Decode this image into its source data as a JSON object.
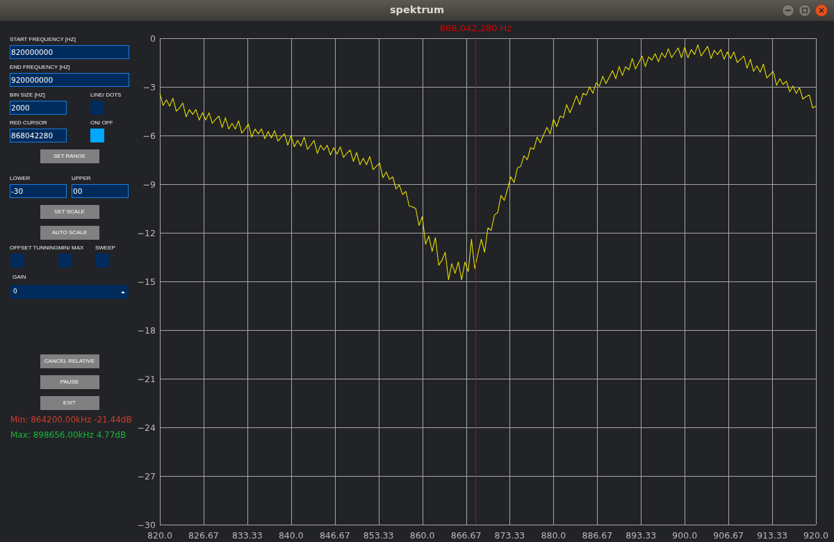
{
  "window": {
    "title": "spektrum"
  },
  "sidebar": {
    "start_frequency": {
      "label": "START FREQUENCY [HZ]",
      "value": "820000000"
    },
    "end_frequency": {
      "label": "END FREQUENCY [HZ]",
      "value": "920000000"
    },
    "bin_size": {
      "label": "BIN SIZE [HZ]",
      "value": "2000"
    },
    "line_dots": {
      "label": "LINE/ DOTS",
      "on": false
    },
    "red_cursor": {
      "label": "RED CURSOR",
      "value": "868042280"
    },
    "cursor_toggle": {
      "label": "ON/ OFF",
      "on": true
    },
    "set_range_button": {
      "label": "SET RANGE"
    },
    "lower": {
      "label": "LOWER",
      "value": "-30"
    },
    "upper": {
      "label": "UPPER",
      "value": "00"
    },
    "scale_buttons": [
      {
        "label": "SET SCALE"
      },
      {
        "label": "AUTO SCALE"
      }
    ],
    "toggles": [
      {
        "label": "OFFSET TUNNING",
        "on": false
      },
      {
        "label": "MIN/ MAX",
        "on": false
      },
      {
        "label": "SWEEP",
        "on": false
      }
    ],
    "gain": {
      "label": "GAIN",
      "value": "0"
    },
    "buttons": [
      {
        "label": "CANCEL RELATIVE"
      },
      {
        "label": "PAUSE"
      },
      {
        "label": "EXIT"
      }
    ],
    "readouts": [
      {
        "text": "Min: 864200.00kHz -21.44dB",
        "color": "#c8402e"
      },
      {
        "text": "Max: 898656.00kHz 4.77dB",
        "color": "#1db33f"
      }
    ]
  },
  "spectrum": {
    "chart_data": {
      "type": "line",
      "color": "#e8e000",
      "grid": true,
      "xlim": [
        820,
        920
      ],
      "ylim": [
        -30,
        0
      ],
      "xticks": [
        {
          "value": 820,
          "label": "820.0"
        },
        {
          "value": 826.67,
          "label": "826.67"
        },
        {
          "value": 833.33,
          "label": "833.33"
        },
        {
          "value": 840,
          "label": "840.0"
        },
        {
          "value": 846.67,
          "label": "846.67"
        },
        {
          "value": 853.33,
          "label": "853.33"
        },
        {
          "value": 860,
          "label": "860.0"
        },
        {
          "value": 866.67,
          "label": "866.67"
        },
        {
          "value": 873.33,
          "label": "873.33"
        },
        {
          "value": 880,
          "label": "880.0"
        },
        {
          "value": 886.67,
          "label": "886.67"
        },
        {
          "value": 893.33,
          "label": "893.33"
        },
        {
          "value": 900,
          "label": "900.0"
        },
        {
          "value": 906.67,
          "label": "906.67"
        },
        {
          "value": 913.33,
          "label": "913.33"
        },
        {
          "value": 920,
          "label": "920.0"
        }
      ],
      "yticks": [
        {
          "value": 0,
          "label": "0"
        },
        {
          "value": -3,
          "label": "−3"
        },
        {
          "value": -6,
          "label": "−6"
        },
        {
          "value": -9,
          "label": "−9"
        },
        {
          "value": -12,
          "label": "−12"
        },
        {
          "value": -15,
          "label": "−15"
        },
        {
          "value": -18,
          "label": "−18"
        },
        {
          "value": -21,
          "label": "−21"
        },
        {
          "value": -24,
          "label": "−24"
        },
        {
          "value": -27,
          "label": "−27"
        },
        {
          "value": -30,
          "label": "−30"
        }
      ],
      "ref_lines": [
        {
          "axis": "x",
          "value": 868.04228,
          "label": "868,042,280 Hz",
          "color": "#d80000"
        }
      ],
      "x": [
        820,
        820.5,
        821,
        821.5,
        822,
        822.5,
        823,
        823.5,
        824,
        824.5,
        825,
        825.5,
        826,
        826.5,
        827,
        827.5,
        828,
        828.5,
        829,
        829.5,
        830,
        830.5,
        831,
        831.5,
        832,
        832.5,
        833,
        833.5,
        834,
        834.5,
        835,
        835.5,
        836,
        836.5,
        837,
        837.5,
        838,
        838.5,
        839,
        839.5,
        840,
        840.5,
        841,
        841.5,
        842,
        842.5,
        843,
        843.5,
        844,
        844.5,
        845,
        845.5,
        846,
        846.5,
        847,
        847.5,
        848,
        848.5,
        849,
        849.5,
        850,
        850.5,
        851,
        851.5,
        852,
        852.5,
        853,
        853.5,
        854,
        854.5,
        855,
        855.5,
        856,
        856.5,
        857,
        857.5,
        858,
        858.5,
        859,
        859.5,
        860,
        860.5,
        861,
        861.5,
        862,
        862.5,
        863,
        863.5,
        864,
        864.5,
        865,
        865.5,
        866,
        866.5,
        867,
        867.5,
        868,
        868.5,
        869,
        869.5,
        870,
        870.5,
        871,
        871.5,
        872,
        872.5,
        873,
        873.5,
        874,
        874.5,
        875,
        875.5,
        876,
        876.5,
        877,
        877.5,
        878,
        878.5,
        879,
        879.5,
        880,
        880.5,
        881,
        881.5,
        882,
        882.5,
        883,
        883.5,
        884,
        884.5,
        885,
        885.5,
        886,
        886.5,
        887,
        887.5,
        888,
        888.5,
        889,
        889.5,
        890,
        890.5,
        891,
        891.5,
        892,
        892.5,
        893,
        893.5,
        894,
        894.5,
        895,
        895.5,
        896,
        896.5,
        897,
        897.5,
        898,
        898.5,
        899,
        899.5,
        900,
        900.5,
        901,
        901.5,
        902,
        902.5,
        903,
        903.5,
        904,
        904.5,
        905,
        905.5,
        906,
        906.5,
        907,
        907.5,
        908,
        908.5,
        909,
        909.5,
        910,
        910.5,
        911,
        911.5,
        912,
        912.5,
        913,
        913.5,
        914,
        914.5,
        915,
        915.5,
        916,
        916.5,
        917,
        917.5,
        918,
        918.5,
        919,
        919.5,
        920
      ],
      "values": [
        -3.4,
        -4.15,
        -3.8,
        -4.2,
        -3.7,
        -4.5,
        -4.3,
        -4.0,
        -4.85,
        -4.4,
        -4.7,
        -4.4,
        -5.05,
        -4.6,
        -5.05,
        -4.6,
        -5.25,
        -5.0,
        -4.8,
        -5.5,
        -4.9,
        -5.6,
        -5.25,
        -5.6,
        -5.1,
        -5.85,
        -5.6,
        -5.3,
        -6.1,
        -5.6,
        -5.9,
        -5.6,
        -6.2,
        -5.75,
        -6.15,
        -5.7,
        -6.35,
        -6.1,
        -5.9,
        -6.6,
        -6.0,
        -6.7,
        -6.3,
        -6.65,
        -6.1,
        -6.85,
        -6.6,
        -6.3,
        -7.1,
        -6.6,
        -6.9,
        -6.6,
        -7.2,
        -6.75,
        -7.15,
        -6.7,
        -7.35,
        -7.1,
        -6.9,
        -7.6,
        -7.05,
        -7.8,
        -7.4,
        -7.8,
        -7.3,
        -8.1,
        -7.9,
        -7.7,
        -8.6,
        -8.25,
        -8.7,
        -8.55,
        -9.3,
        -9.05,
        -9.65,
        -9.45,
        -10.35,
        -10.4,
        -10.5,
        -11.55,
        -11.0,
        -12.7,
        -12.2,
        -13.15,
        -12.3,
        -14.0,
        -13.7,
        -13.2,
        -14.9,
        -13.9,
        -14.5,
        -13.8,
        -14.9,
        -13.8,
        -14.4,
        -12.4,
        -14.2,
        -13.25,
        -12.4,
        -13.2,
        -11.7,
        -11.85,
        -10.9,
        -10.75,
        -9.7,
        -10.0,
        -9.3,
        -8.55,
        -8.9,
        -8.0,
        -7.9,
        -7.25,
        -7.5,
        -6.75,
        -6.85,
        -6.1,
        -6.45,
        -5.95,
        -5.5,
        -5.9,
        -5.0,
        -5.45,
        -4.8,
        -4.9,
        -4.1,
        -4.6,
        -4.1,
        -3.55,
        -4.1,
        -3.4,
        -3.5,
        -3.0,
        -3.4,
        -2.75,
        -2.95,
        -2.35,
        -2.8,
        -2.4,
        -2.0,
        -2.5,
        -1.75,
        -2.3,
        -1.75,
        -1.95,
        -1.25,
        -1.9,
        -1.5,
        -1.1,
        -1.75,
        -1.15,
        -1.35,
        -0.95,
        -1.45,
        -0.9,
        -1.2,
        -0.65,
        -1.2,
        -0.9,
        -0.6,
        -1.2,
        -0.55,
        -1.2,
        -0.7,
        -1.0,
        -0.4,
        -1.1,
        -0.8,
        -0.5,
        -1.25,
        -0.75,
        -1.0,
        -0.7,
        -1.3,
        -0.85,
        -1.25,
        -0.85,
        -1.5,
        -1.3,
        -1.1,
        -1.85,
        -1.3,
        -2.05,
        -1.7,
        -2.1,
        -1.6,
        -2.45,
        -2.25,
        -2.05,
        -2.9,
        -2.5,
        -2.85,
        -2.65,
        -3.3,
        -2.95,
        -3.4,
        -3.05,
        -3.75,
        -3.6,
        -3.5,
        -4.3,
        -4.2
      ]
    }
  }
}
